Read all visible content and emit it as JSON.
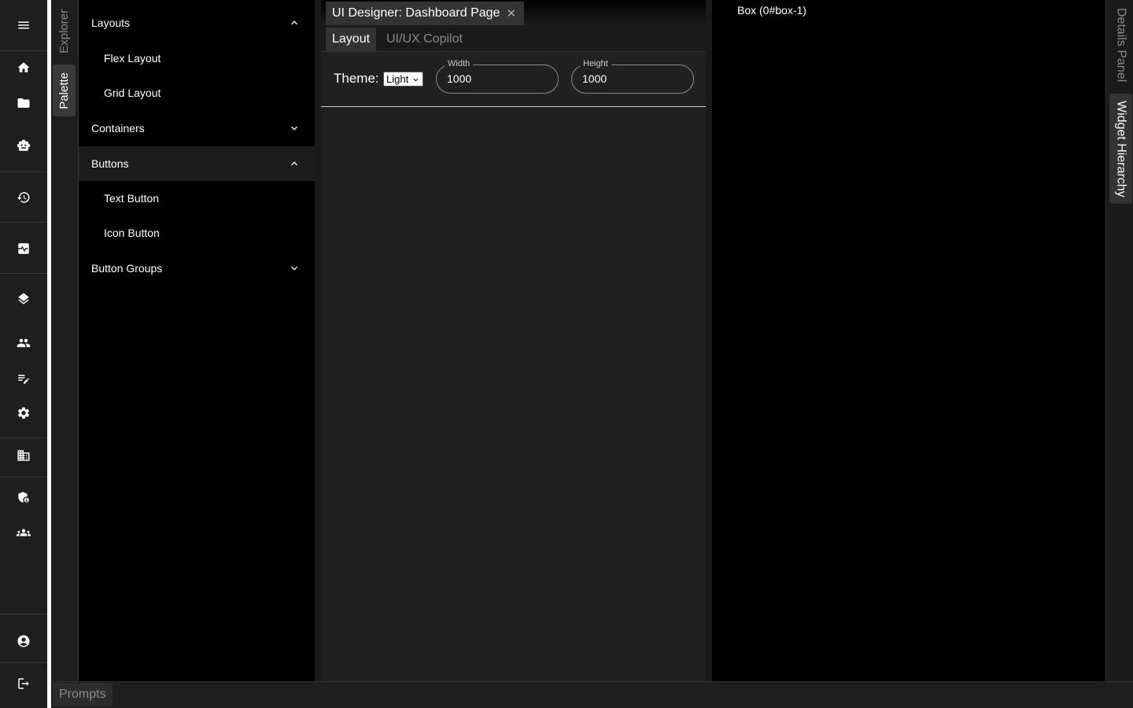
{
  "rail": {
    "items": [
      {
        "name": "menu-icon"
      },
      {
        "name": "home-icon"
      },
      {
        "name": "folder-icon"
      },
      {
        "name": "robot-icon"
      },
      {
        "name": "history-icon"
      },
      {
        "name": "activity-icon"
      },
      {
        "name": "layers-icon"
      },
      {
        "name": "people-icon"
      },
      {
        "name": "edit-note-icon"
      },
      {
        "name": "gear-icon"
      },
      {
        "name": "building-icon"
      },
      {
        "name": "admin-shield-icon"
      },
      {
        "name": "groups-icon"
      },
      {
        "name": "account-circle-icon"
      },
      {
        "name": "logout-icon"
      }
    ]
  },
  "left_tabs": {
    "explorer": "Explorer",
    "palette": "Palette"
  },
  "palette": {
    "groups": [
      {
        "label": "Layouts",
        "expanded": true,
        "items": [
          "Flex Layout",
          "Grid Layout"
        ]
      },
      {
        "label": "Containers",
        "expanded": false,
        "items": []
      },
      {
        "label": "Buttons",
        "expanded": true,
        "items": [
          "Text Button",
          "Icon Button"
        ]
      },
      {
        "label": "Button Groups",
        "expanded": false,
        "items": []
      }
    ]
  },
  "editor": {
    "doc_tab_title": "UI Designer: Dashboard Page",
    "doc_tab_close": "✕",
    "sub_tabs": [
      "Layout",
      "UI/UX Copilot"
    ],
    "theme_label": "Theme:",
    "theme_value": "Light",
    "width_label": "Width",
    "width_value": "1000",
    "height_label": "Height",
    "height_value": "1000"
  },
  "details": {
    "text": "Box (0#box-1)"
  },
  "right_tabs": {
    "details_panel": "Details Panel",
    "widget_hierarchy": "Widget Hierarchy"
  },
  "bottom": {
    "prompts": "Prompts"
  },
  "colors": {
    "rail_bg": "#1e1e1e",
    "panel_bg": "#000000",
    "editor_bg": "#202020",
    "active_tab": "#333333"
  }
}
